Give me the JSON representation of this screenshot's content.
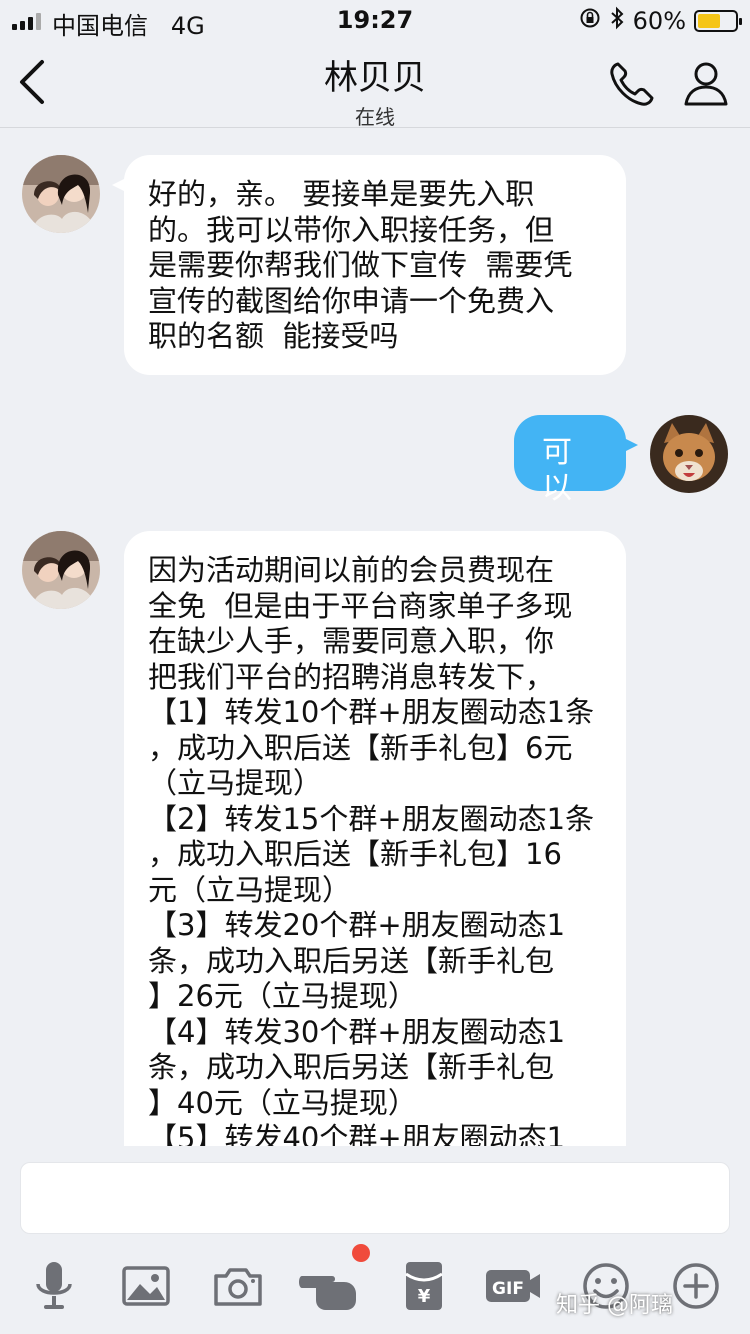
{
  "status_bar": {
    "carrier": "中国电信",
    "network": "4G",
    "time": "19:27",
    "battery": "60%",
    "battery_level": 0.6
  },
  "header": {
    "title": "林贝贝",
    "subtitle": "在线"
  },
  "messages": [
    {
      "direction": "incoming",
      "text": "好的，亲。 要接单是要先入职\n的。我可以带你入职接任务，但\n是需要你帮我们做下宣传  需要凭\n宣传的截图给你申请一个免费入\n职的名额  能接受吗"
    },
    {
      "direction": "outgoing",
      "text": "可以"
    },
    {
      "direction": "incoming",
      "text": "因为活动期间以前的会员费现在\n全免  但是由于平台商家单子多现\n在缺少人手，需要同意入职，你\n把我们平台的招聘消息转发下，\n【1】转发10个群+朋友圈动态1条\n，成功入职后送【新手礼包】6元\n（立马提现）\n【2】转发15个群+朋友圈动态1条\n，成功入职后送【新手礼包】16\n元（立马提现）\n【3】转发20个群+朋友圈动态1\n条，成功入职后另送【新手礼包\n】26元（立马提现）\n【4】转发30个群+朋友圈动态1\n条，成功入职后另送【新手礼包\n】40元（立马提现）\n【5】转发40个群+朋友圈动态1"
    }
  ],
  "input": {
    "value": "",
    "placeholder": ""
  },
  "toolbar": {
    "items": [
      "mic-icon",
      "image-icon",
      "camera-icon",
      "poke-icon",
      "red-packet-icon",
      "gif-icon",
      "emoji-icon",
      "plus-icon"
    ],
    "gif_label": "GIF",
    "red_packet_label": "¥"
  },
  "watermark": "知乎 @阿璃",
  "colors": {
    "background": "#eef0f4",
    "outgoing_bubble": "#43b4f4",
    "incoming_bubble": "#ffffff",
    "badge": "#f04b3c"
  }
}
